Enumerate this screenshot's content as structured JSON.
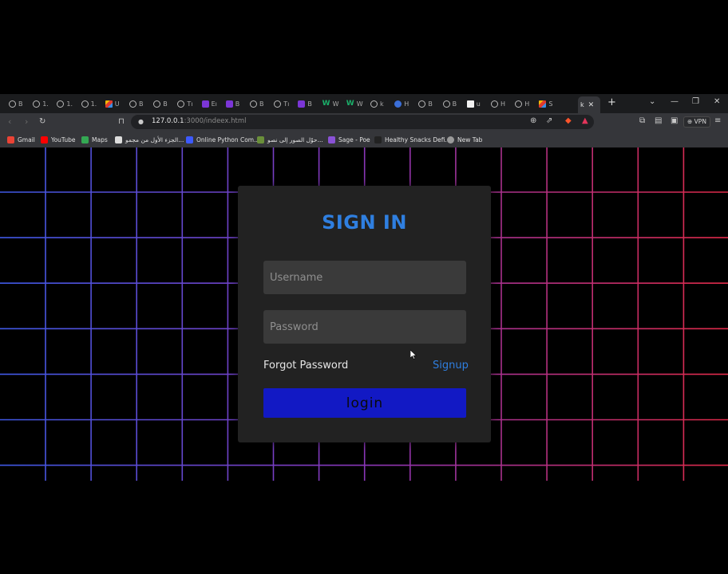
{
  "browser": {
    "tabs": [
      {
        "label": "B",
        "favicon": "globe-icon"
      },
      {
        "label": "1.",
        "favicon": "globe-icon"
      },
      {
        "label": "1.",
        "favicon": "globe-icon"
      },
      {
        "label": "1.",
        "favicon": "globe-icon"
      },
      {
        "label": "U",
        "favicon": "multicolor-icon"
      },
      {
        "label": "B",
        "favicon": "globe-icon"
      },
      {
        "label": "B",
        "favicon": "globe-icon"
      },
      {
        "label": "Tı",
        "favicon": "globe-icon"
      },
      {
        "label": "Eı",
        "favicon": "bootstrap-icon"
      },
      {
        "label": "B",
        "favicon": "bootstrap-icon"
      },
      {
        "label": "B",
        "favicon": "globe-icon"
      },
      {
        "label": "Tı",
        "favicon": "globe-icon"
      },
      {
        "label": "B",
        "favicon": "bootstrap-icon"
      },
      {
        "label": "W",
        "favicon": "w-icon"
      },
      {
        "label": "W",
        "favicon": "w-icon"
      },
      {
        "label": "k",
        "favicon": "globe-icon"
      },
      {
        "label": "H",
        "favicon": "blue-circle-icon"
      },
      {
        "label": "B",
        "favicon": "globe-icon"
      },
      {
        "label": "B",
        "favicon": "globe-icon"
      },
      {
        "label": "u",
        "favicon": "u-icon"
      },
      {
        "label": "H",
        "favicon": "globe-icon"
      },
      {
        "label": "H",
        "favicon": "globe-icon"
      },
      {
        "label": "S",
        "favicon": "multicolor-icon"
      },
      {
        "label": "k",
        "favicon": "none",
        "active": true
      }
    ],
    "new_tab": "+",
    "url_host": "127.0.0.1",
    "url_path": ":3000/indeex.html",
    "vpn_label": "⊕ VPN",
    "bookmarks": [
      {
        "label": "Gmail",
        "color": "#ea4335"
      },
      {
        "label": "YouTube",
        "color": "#ff0000"
      },
      {
        "label": "Maps",
        "color": "#34a853"
      },
      {
        "label": "الجزء الأول من مجمو...",
        "color": "#dddddd"
      },
      {
        "label": "Online Python Com...",
        "color": "#3d5afe"
      },
      {
        "label": "حوّل الصور إلى نصو...",
        "color": "#6a8f3a"
      },
      {
        "label": "Sage - Poe",
        "color": "#8a52d6"
      },
      {
        "label": "Healthy Snacks Defi...",
        "color": "#222222"
      },
      {
        "label": "New Tab",
        "color": "#9a9a9a"
      }
    ]
  },
  "login_form": {
    "title": "SIGN IN",
    "username_placeholder": "Username",
    "password_placeholder": "Password",
    "forgot_label": "Forgot Password",
    "signup_label": "Signup",
    "login_label": "login"
  },
  "colors": {
    "accent": "#2f7fe0",
    "login_button": "#1219c4",
    "card_bg": "#222222",
    "grid_left": "#3f59e6",
    "grid_right": "#e02a48"
  }
}
